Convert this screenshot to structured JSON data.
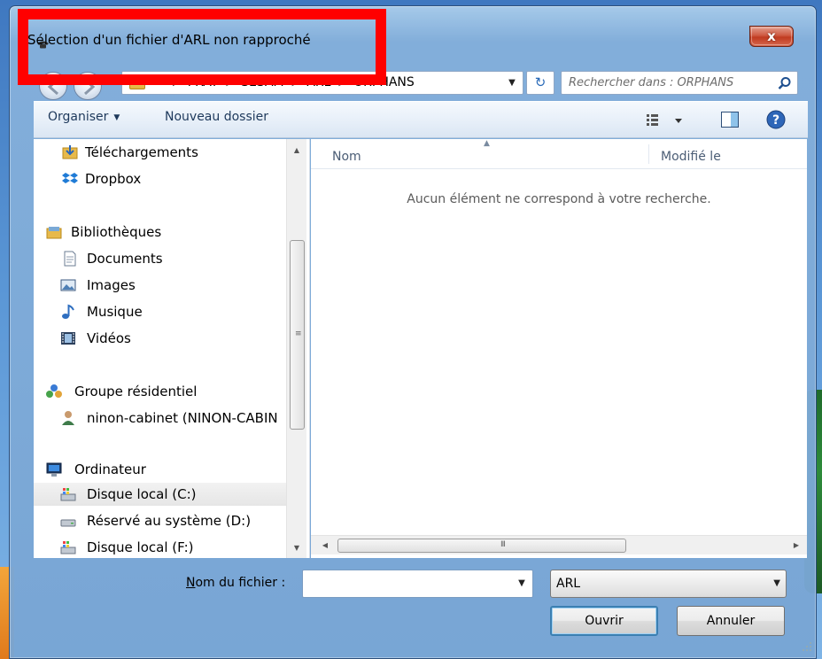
{
  "window": {
    "title": "Sélection d'un fichier d'ARL non rapproché",
    "close_glyph": "x"
  },
  "navigation": {
    "back_icon": "back-arrow-icon",
    "forward_icon": "forward-arrow-icon",
    "breadcrumbs": [
      "PRAT",
      "SESAM",
      "ARL",
      "ORPHANS"
    ],
    "refresh_glyph": "↻"
  },
  "search": {
    "placeholder": "Rechercher dans : ORPHANS"
  },
  "toolbar": {
    "organise_label": "Organiser",
    "new_folder_label": "Nouveau dossier"
  },
  "sidebar": {
    "items": [
      {
        "label": "Téléchargements",
        "icon": "downloads-folder-icon"
      },
      {
        "label": "Dropbox",
        "icon": "dropbox-icon"
      },
      {
        "label": "Bibliothèques",
        "icon": "libraries-icon"
      },
      {
        "label": "Documents",
        "icon": "documents-icon"
      },
      {
        "label": "Images",
        "icon": "images-icon"
      },
      {
        "label": "Musique",
        "icon": "music-icon"
      },
      {
        "label": "Vidéos",
        "icon": "videos-icon"
      },
      {
        "label": "Groupe résidentiel",
        "icon": "homegroup-icon"
      },
      {
        "label": "ninon-cabinet (NINON-CABIN",
        "icon": "user-icon"
      },
      {
        "label": "Ordinateur",
        "icon": "computer-icon"
      },
      {
        "label": "Disque local (C:)",
        "icon": "local-disk-icon",
        "selected": true
      },
      {
        "label": "Réservé au système (D:)",
        "icon": "drive-icon"
      },
      {
        "label": "Disque local (F:)",
        "icon": "local-disk-icon"
      }
    ]
  },
  "file_list": {
    "columns": [
      "Nom",
      "Modifié le"
    ],
    "empty_message": "Aucun élément ne correspond à votre recherche."
  },
  "bottom": {
    "filename_label_prefix": "N",
    "filename_label_rest": "om du fichier :",
    "filename_value": "",
    "filetype_value": "ARL",
    "open_label": "Ouvrir",
    "cancel_label": "Annuler"
  },
  "colors": {
    "annotation_box": "#ff0000",
    "window_frame": "#85b0db",
    "close_button": "#c03a20",
    "selection": "#e6e6e6"
  }
}
